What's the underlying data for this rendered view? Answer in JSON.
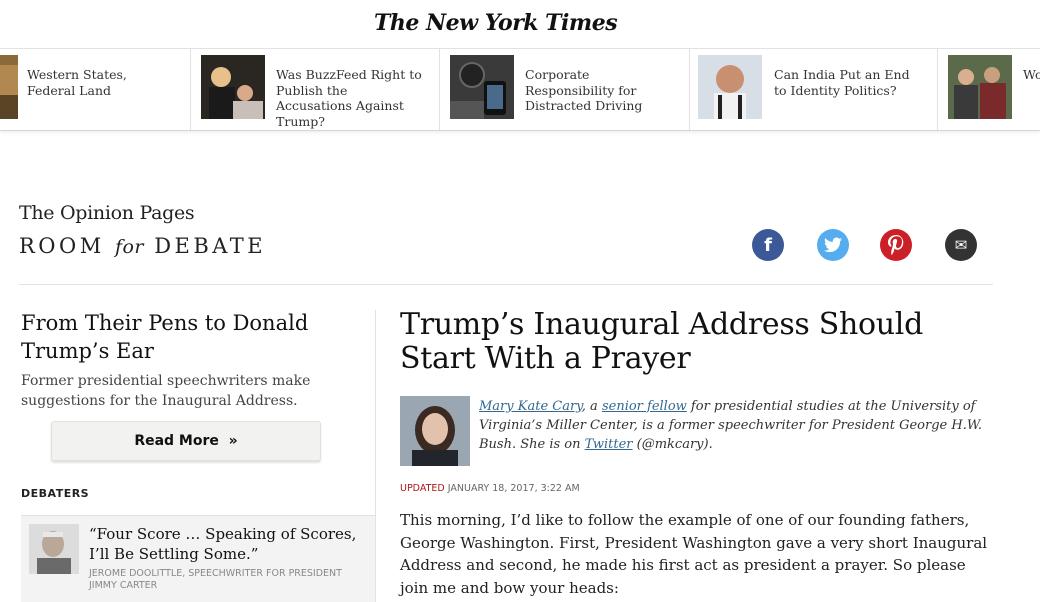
{
  "masthead": {
    "logo": "The New York Times"
  },
  "ribbon": {
    "items": [
      {
        "title": "Western States, Federal Land"
      },
      {
        "title": "Was BuzzFeed Right to Publish the Accusations Against Trump?"
      },
      {
        "title": "Corporate Responsibility for Distracted Driving"
      },
      {
        "title": "Can India Put an End to Identity Politics?"
      },
      {
        "title": "Wo on"
      }
    ]
  },
  "header": {
    "section": "The Opinion Pages",
    "rfd_room": "ROOM",
    "rfd_for": "for",
    "rfd_debate": "DEBATE"
  },
  "share": {
    "facebook": "f",
    "twitter": "t",
    "pinterest": "p",
    "email": "✉"
  },
  "sidebar": {
    "title": "From Their Pens to Donald Trump’s Ear",
    "description": "Former presidential speechwriters make suggestions for the Inaugural Address.",
    "read_more": "Read More",
    "read_more_arrow": "»",
    "debaters_heading": "DEBATERS",
    "debater": {
      "quote": "“Four Score … Speaking of Scores, I’ll Be Settling Some.”",
      "byline": "JEROME DOOLITTLE, SPEECHWRITER FOR PRESIDENT JIMMY CARTER"
    }
  },
  "article": {
    "title": "Trump’s Inaugural Address Should Start With a  Prayer",
    "author_name": "Mary Kate Cary",
    "bio_sep": ", a ",
    "bio_role": "senior fellow",
    "bio_rest": " for presidential studies at the University of Virginia’s Miller Center, is a former speechwriter for President George H.W. Bush. She is on ",
    "bio_twitter": "Twitter",
    "bio_handle": " (@mkcary).",
    "updated_label": "UPDATED",
    "updated_date": "JANUARY 18, 2017, 3:22 AM",
    "body": "This morning, I’d like to follow the example of one of our founding fathers, George Washington. First, President Washington gave a very short Inaugural Address and second, he made his first act as president a prayer. So please join me and bow your heads:"
  },
  "colors": {
    "facebook": "#3b5998",
    "twitter": "#55acee",
    "pinterest": "#cb2027",
    "email": "#333333",
    "link": "#326891",
    "updated": "#a81817"
  }
}
